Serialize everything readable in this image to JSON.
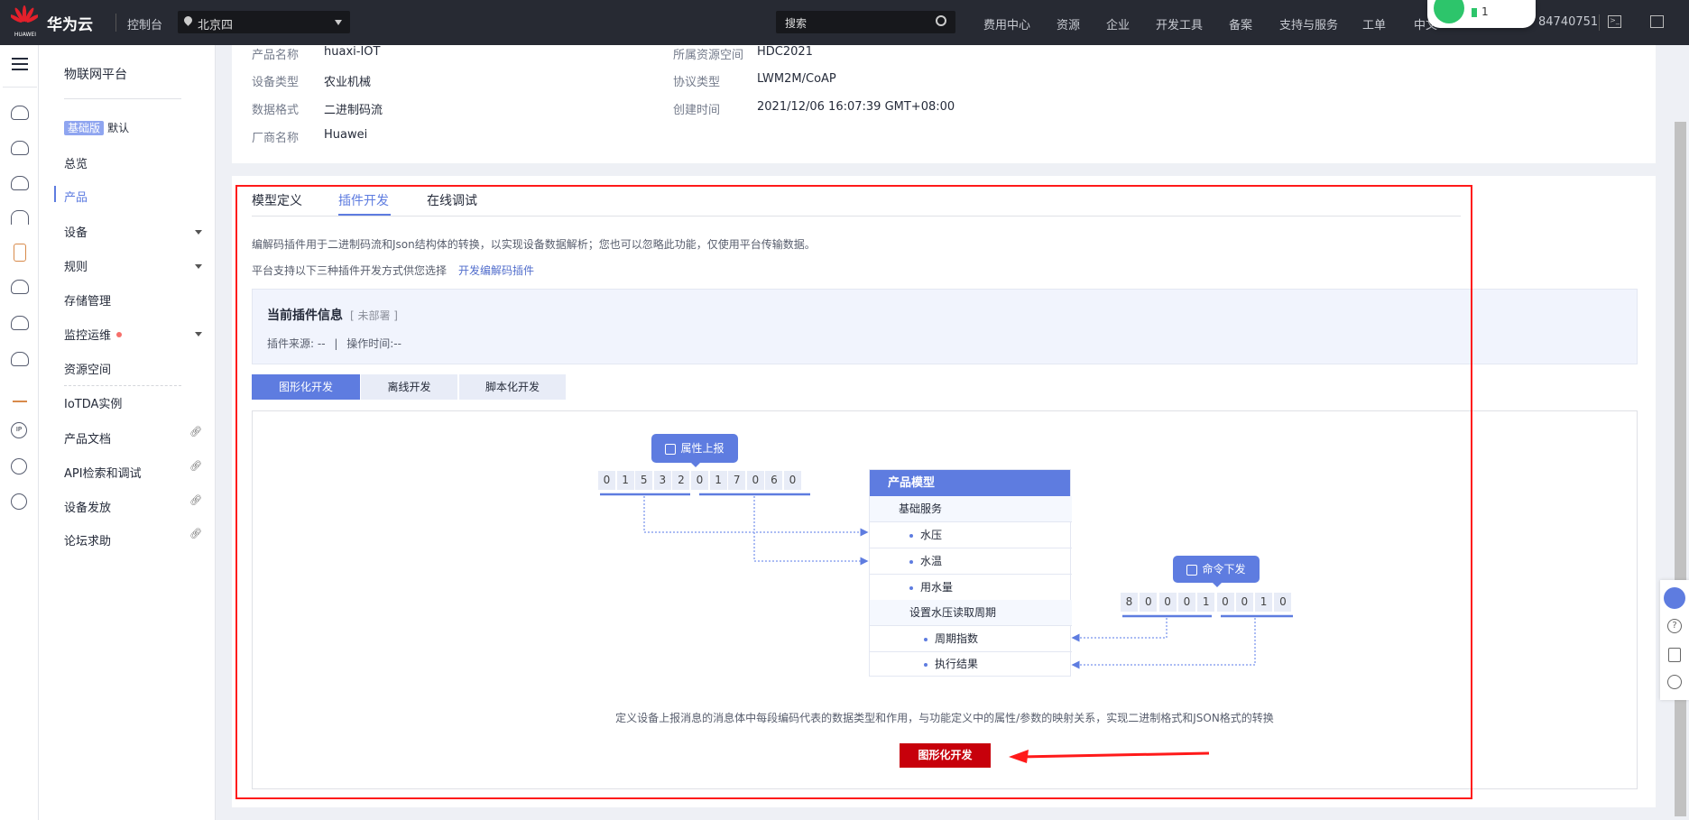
{
  "header": {
    "brand_small": "HUAWEI",
    "brand": "华为云",
    "console": "控制台",
    "region": "北京四",
    "search_placeholder": "搜索",
    "nav": [
      "费用中心",
      "资源",
      "企业",
      "开发工具",
      "备案",
      "支持与服务",
      "工单",
      "中文"
    ],
    "account": "84740751",
    "wifi_count": "1"
  },
  "sidebar": {
    "title": "物联网平台",
    "edition_badge": "基础版",
    "edition_label": "默认",
    "items": [
      {
        "label": "总览"
      },
      {
        "label": "产品",
        "active": true
      },
      {
        "label": "设备",
        "expandable": true
      },
      {
        "label": "规则",
        "expandable": true
      },
      {
        "label": "存储管理"
      },
      {
        "label": "监控运维",
        "expandable": true,
        "alert": true
      },
      {
        "label": "资源空间"
      }
    ],
    "links": [
      {
        "label": "IoTDA实例"
      },
      {
        "label": "产品文档"
      },
      {
        "label": "API检索和调试"
      },
      {
        "label": "设备发放"
      },
      {
        "label": "论坛求助"
      }
    ]
  },
  "product_info": {
    "name_label": "产品名称",
    "name": "huaxi-IOT",
    "space_label": "所属资源空间",
    "space": "HDC2021",
    "type_label": "设备类型",
    "type": "农业机械",
    "protocol_label": "协议类型",
    "protocol": "LWM2M/CoAP",
    "format_label": "数据格式",
    "format": "二进制码流",
    "created_label": "创建时间",
    "created": "2021/12/06 16:07:39 GMT+08:00",
    "vendor_label": "厂商名称",
    "vendor": "Huawei"
  },
  "tabs": [
    {
      "label": "模型定义"
    },
    {
      "label": "插件开发",
      "active": true
    },
    {
      "label": "在线调试"
    }
  ],
  "plugin": {
    "desc": "编解码插件用于二进制码流和Json结构体的转换，以实现设备数据解析；您也可以忽略此功能，仅使用平台传输数据。",
    "support_text": "平台支持以下三种插件开发方式供您选择",
    "support_link": "开发编解码插件",
    "current_title": "当前插件信息",
    "current_status": "[ 未部署 ]",
    "source": "插件来源: --",
    "sep": "|",
    "op_time": "操作时间:--",
    "dev_tabs": [
      {
        "label": "图形化开发",
        "active": true
      },
      {
        "label": "离线开发"
      },
      {
        "label": "脚本化开发"
      }
    ],
    "diagram": {
      "report_badge": "属性上报",
      "report_digits": [
        "0",
        "1",
        "5",
        "3",
        "2",
        "0",
        "1",
        "7",
        "0",
        "6",
        "0"
      ],
      "model_title": "产品模型",
      "service": "基础服务",
      "properties": [
        "水压",
        "水温",
        "用水量"
      ],
      "command": "设置水压读取周期",
      "command_fields": [
        "周期指数",
        "执行结果"
      ],
      "command_badge": "命令下发",
      "command_digits": [
        "8",
        "0",
        "0",
        "0",
        "1",
        "0",
        "0",
        "1",
        "0"
      ]
    },
    "footer_desc": "定义设备上报消息的消息体中每段编码代表的数据类型和作用，与功能定义中的属性/参数的映射关系，实现二进制格式和JSON格式的转换",
    "cta": "图形化开发"
  },
  "colors": {
    "accent": "#5e7ce0",
    "highlight_box": "#ff1a1a",
    "cta": "#c7000b",
    "header_bg": "#272a33"
  }
}
